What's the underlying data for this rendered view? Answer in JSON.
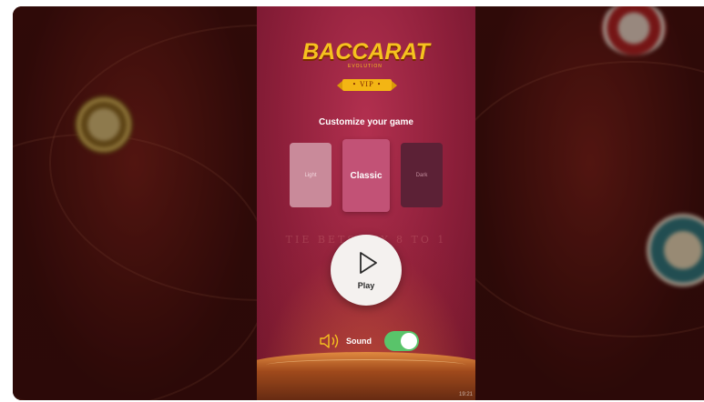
{
  "logo": {
    "title": "BACCARAT",
    "subtitle": "EVOLUTION",
    "badge": "• VIP •"
  },
  "customize": {
    "heading": "Customize your game",
    "themes": [
      {
        "label": "Light",
        "selected": false
      },
      {
        "label": "Classic",
        "selected": true
      },
      {
        "label": "Dark",
        "selected": false
      }
    ]
  },
  "table_text": "TIE BETS PAY 8 TO 1",
  "play": {
    "label": "Play",
    "icon": "play-icon"
  },
  "sound": {
    "label": "Sound",
    "icon": "speaker-icon",
    "enabled": true
  },
  "clock": "19:21",
  "colors": {
    "panel": "#8d1f3a",
    "accent_gold": "#f6c21f",
    "toggle_on": "#59c46a"
  }
}
